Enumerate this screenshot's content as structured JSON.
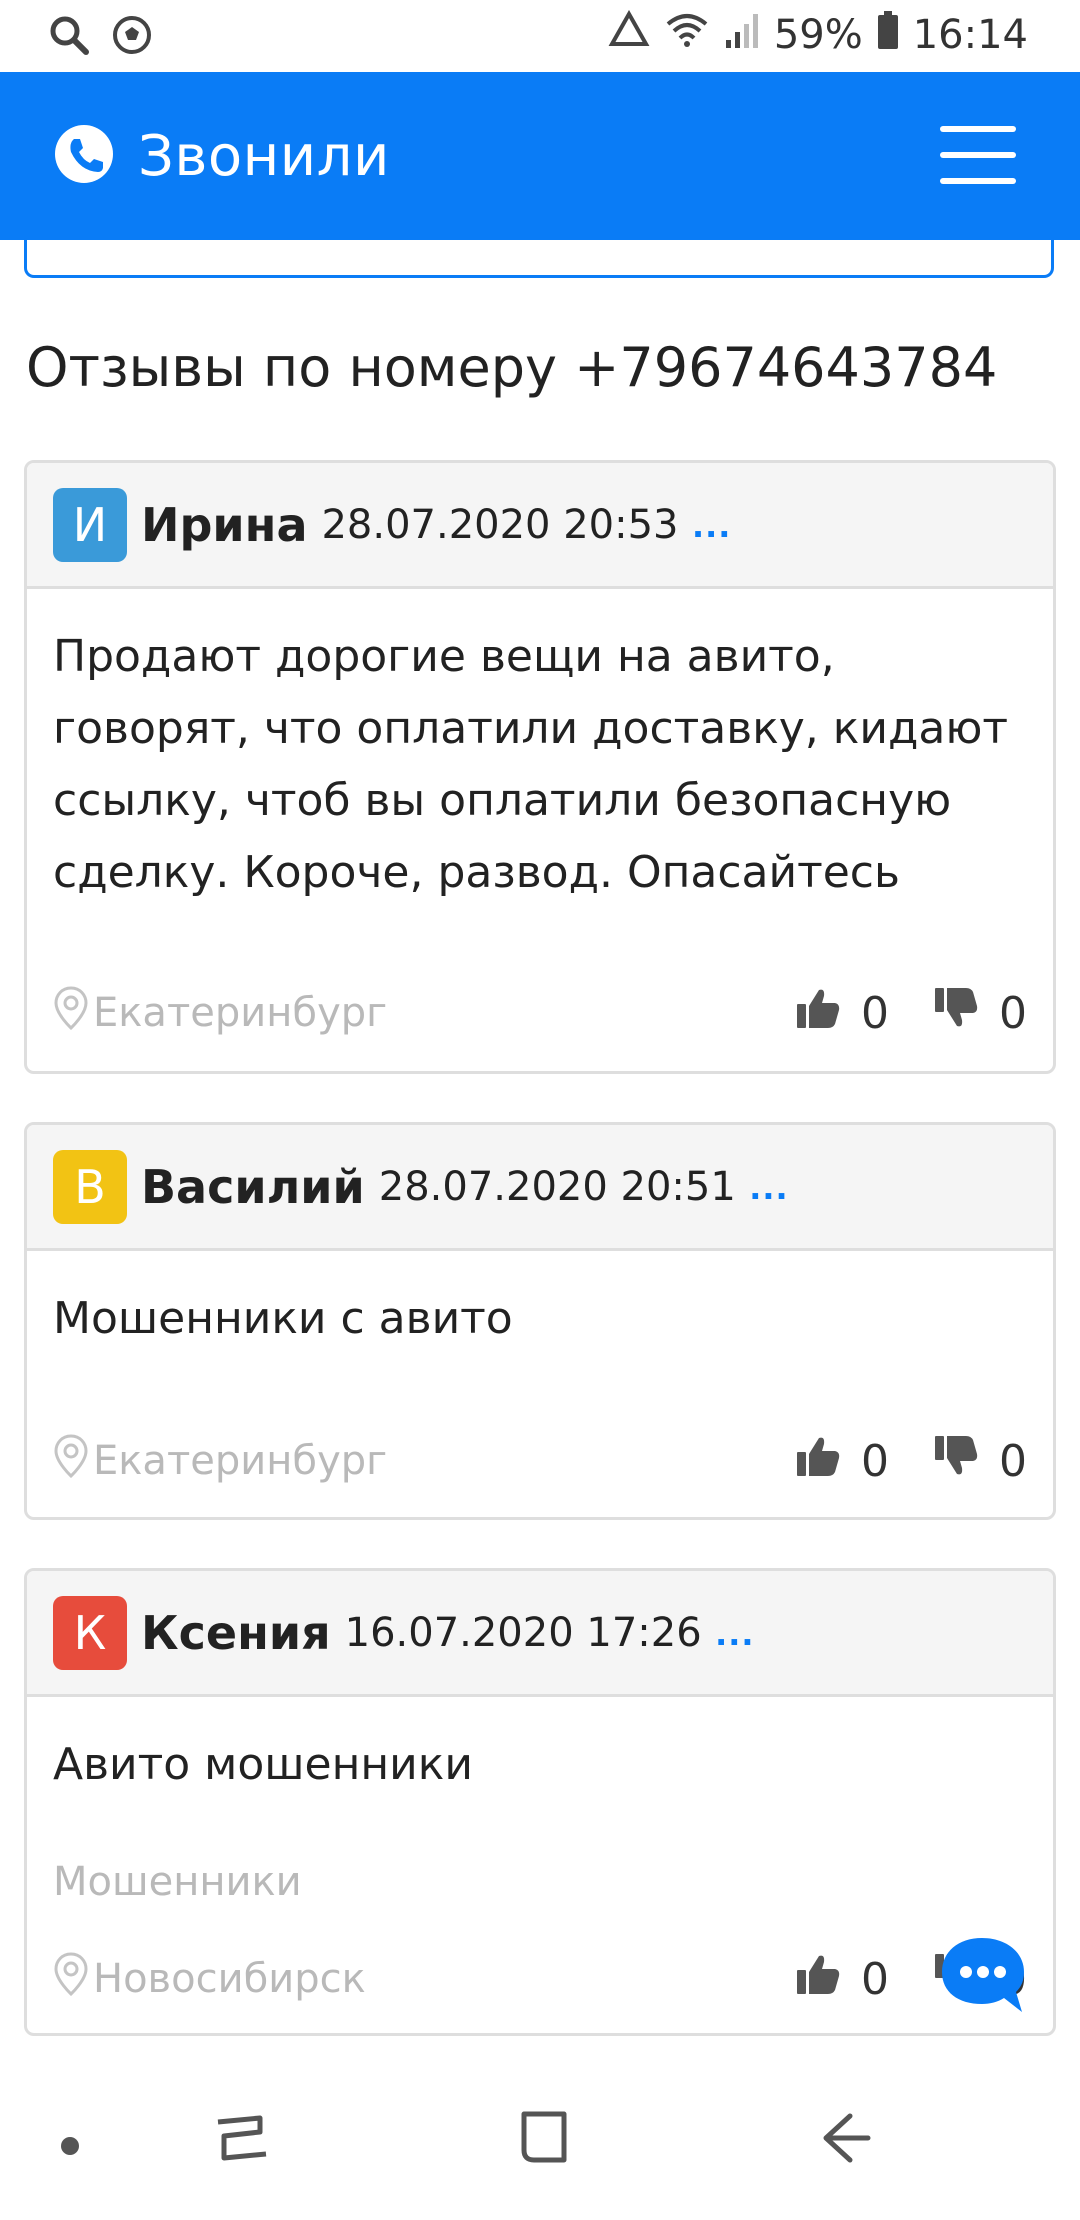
{
  "status_bar": {
    "battery_percent": "59%",
    "time": "16:14",
    "left_icons": [
      "search-icon",
      "soccer-ball-icon"
    ],
    "right_icons": [
      "recycle-icon",
      "wifi-icon",
      "signal-icon",
      "battery-icon"
    ]
  },
  "app_bar": {
    "title": "Звонили",
    "logo_icon": "phone-icon",
    "menu_icon": "hamburger-menu-icon",
    "color": "#0a7cf6"
  },
  "page": {
    "heading": "Отзывы по номеру +79674643784"
  },
  "reviews": [
    {
      "avatar_letter": "И",
      "avatar_color": "#3a9ad9",
      "author": "Ирина",
      "date": "28.07.2020 20:53",
      "more": "...",
      "text": "Продают дорогие вещи на авито, говорят, что оплатили доставку, кидают ссылку, чтоб вы оплатили безопасную сделку. Короче, развод. Опасайтесь",
      "tag": "",
      "city": "Екатеринбург",
      "likes": "0",
      "dislikes": "0"
    },
    {
      "avatar_letter": "В",
      "avatar_color": "#f2c314",
      "author": "Василий",
      "date": "28.07.2020 20:51",
      "more": "...",
      "text": "Мошенники с авито",
      "tag": "",
      "city": "Екатеринбург",
      "likes": "0",
      "dislikes": "0"
    },
    {
      "avatar_letter": "К",
      "avatar_color": "#e74c3c",
      "author": "Ксения",
      "date": "16.07.2020 17:26",
      "more": "...",
      "text": "Авито мошенники",
      "tag": "Мошенники",
      "city": "Новосибирск",
      "likes": "0",
      "dislikes": "0"
    }
  ],
  "chat_fab": {
    "icon": "chat-bubble-icon"
  },
  "nav_bar": {
    "icons": [
      "dot-icon",
      "recent-apps-icon",
      "home-icon",
      "back-icon"
    ]
  }
}
